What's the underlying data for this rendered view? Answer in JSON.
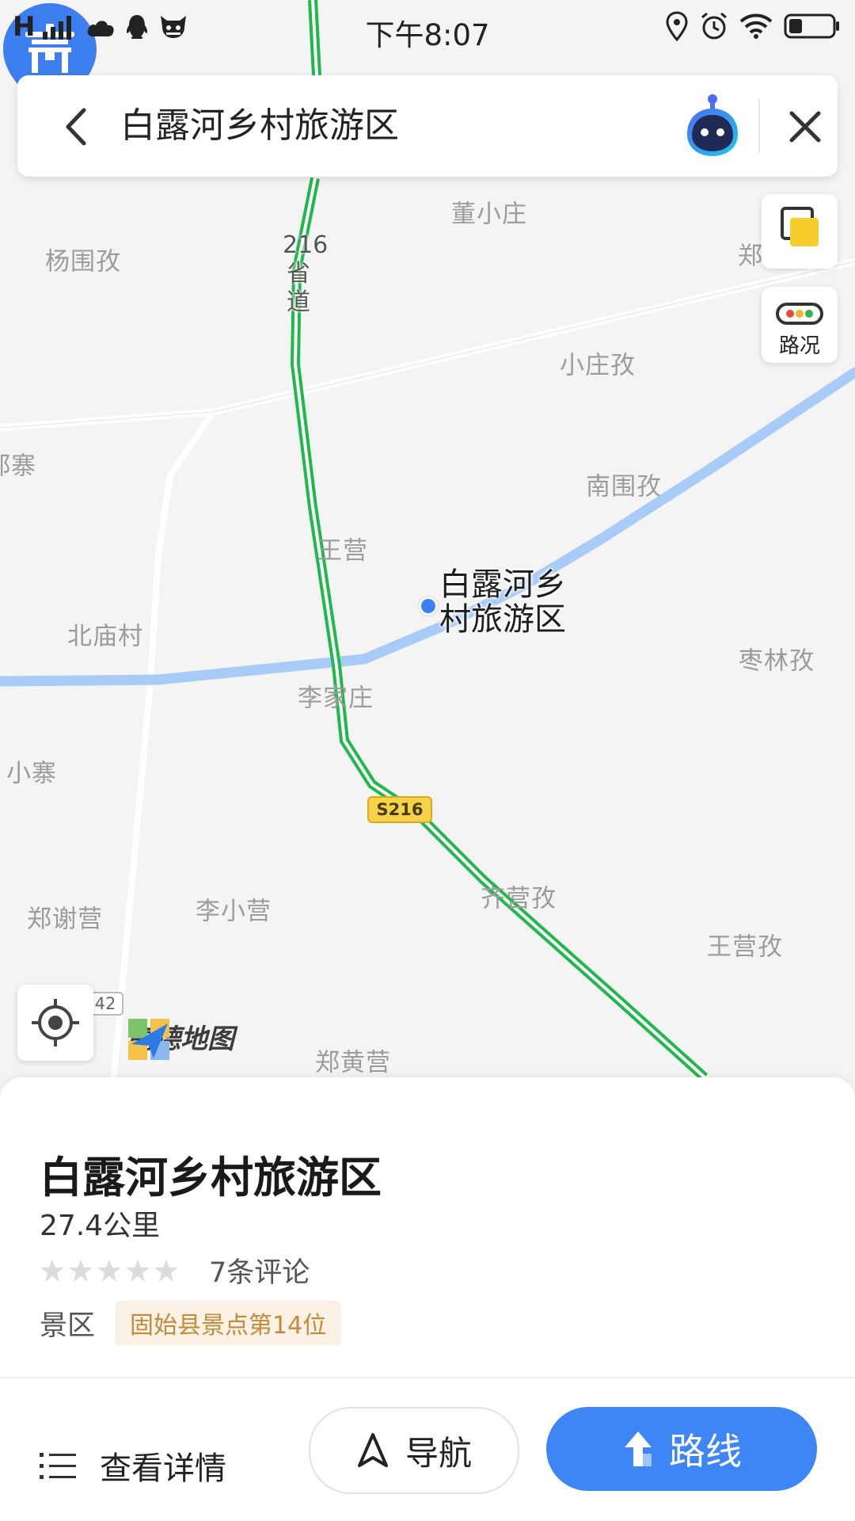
{
  "status_bar": {
    "signal_text": "H",
    "time": "下午8:07",
    "icons": [
      "signal-icon",
      "cloud-icon",
      "qq-icon",
      "app-icon",
      "location-icon",
      "alarm-icon",
      "wifi-icon",
      "battery-icon"
    ]
  },
  "search": {
    "query": "白露河乡村旅游区"
  },
  "map": {
    "labels": [
      {
        "name": "map-label",
        "text": "董小庄"
      },
      {
        "name": "map-label",
        "text": "杨围孜"
      },
      {
        "name": "map-label",
        "text": "郑"
      },
      {
        "name": "map-label",
        "text": "小庄孜"
      },
      {
        "name": "map-label",
        "text": "郑寨"
      },
      {
        "name": "map-label",
        "text": "南围孜"
      },
      {
        "name": "map-label",
        "text": "王营"
      },
      {
        "name": "map-label",
        "text": "北庙村"
      },
      {
        "name": "map-label",
        "text": "枣林孜"
      },
      {
        "name": "map-label",
        "text": "李家庄"
      },
      {
        "name": "map-label",
        "text": "小寨"
      },
      {
        "name": "map-label",
        "text": "郑谢营"
      },
      {
        "name": "map-label",
        "text": "李小营"
      },
      {
        "name": "map-label",
        "text": "齐营孜"
      },
      {
        "name": "map-label",
        "text": "王营孜"
      },
      {
        "name": "map-label",
        "text": "郑黄营"
      }
    ],
    "road_name_vertical": "216省道",
    "road_badge": "S216",
    "road_badge_2": "42",
    "poi_label": "白露河乡\n村旅游区",
    "traffic_label": "路况",
    "logo_text": "高德地图"
  },
  "place": {
    "title": "白露河乡村旅游区",
    "distance": "27.4公里",
    "rating_stars": 0,
    "review_count": "7条评论",
    "category": "景区",
    "rank": "固始县景点第14位"
  },
  "actions": {
    "details": "查看详情",
    "navigate": "导航",
    "route": "路线"
  },
  "colors": {
    "accent": "#3e86f5",
    "road_green": "#1fb84a",
    "river": "#a9cbf7",
    "rank_text": "#c48a3c"
  }
}
